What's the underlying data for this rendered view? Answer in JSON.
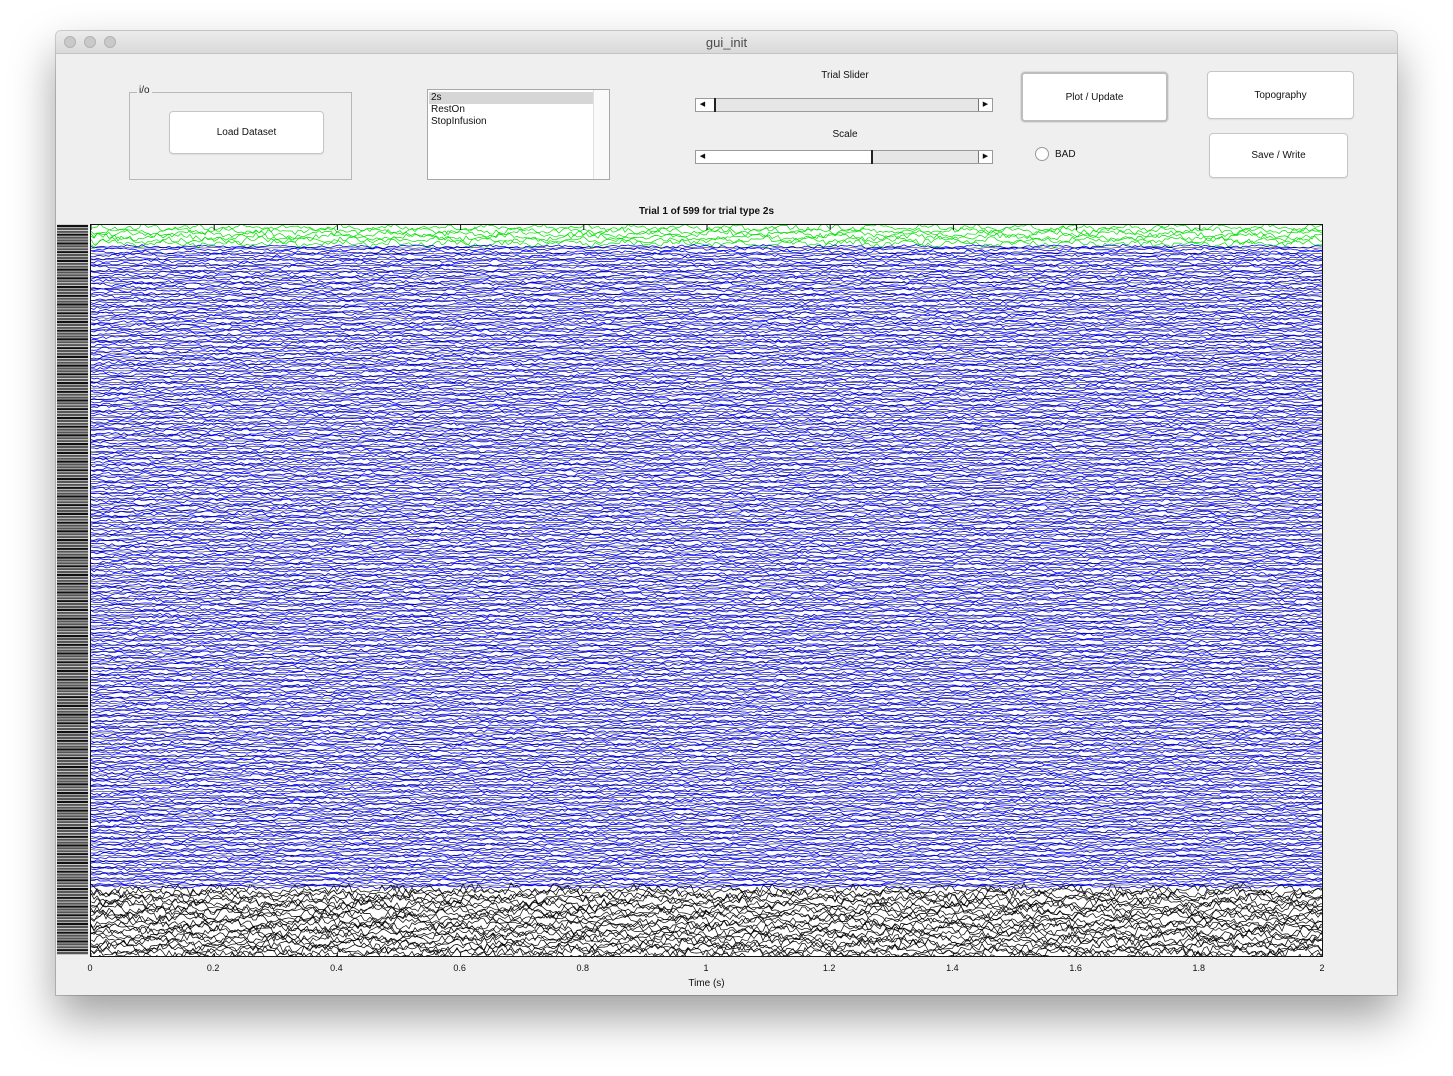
{
  "window": {
    "title": "gui_init"
  },
  "io_panel": {
    "title": "i/o",
    "load_button": "Load Dataset"
  },
  "trial_types": {
    "items": [
      "2s",
      "RestOn",
      "StopInfusion"
    ],
    "selected": "2s"
  },
  "trial_slider": {
    "label": "Trial Slider",
    "position_fraction": 0.02
  },
  "scale_slider": {
    "label": "Scale",
    "position_fraction": 0.6
  },
  "buttons": {
    "plot_update": "Plot / Update",
    "topography": "Topography",
    "save_write": "Save / Write"
  },
  "bad_toggle": {
    "label": "BAD",
    "checked": false
  },
  "colors": {
    "meg_channels": "#0000ff",
    "reference_channels": "#00e000",
    "other_channels": "#000000",
    "window_bg": "#efefef"
  },
  "plot": {
    "title": "Trial 1 of 599 for trial type 2s",
    "xlabel": "Time (s)",
    "y_first_label": "",
    "y_last_label": ""
  },
  "chart_data": {
    "type": "line",
    "title": "Trial 1 of 599 for trial type 2s",
    "xlabel": "Time (s)",
    "xlim": [
      0,
      2
    ],
    "x_ticks": [
      "0",
      "0.2",
      "0.4",
      "0.6",
      "0.8",
      "1",
      "1.2",
      "1.4",
      "1.6",
      "1.8",
      "2"
    ],
    "grid": false,
    "series_groups": [
      {
        "color": "#00e000",
        "trace_count": 6
      },
      {
        "color": "#0000ff",
        "trace_count": 220
      },
      {
        "color": "#000000",
        "trace_count": 25
      }
    ]
  }
}
